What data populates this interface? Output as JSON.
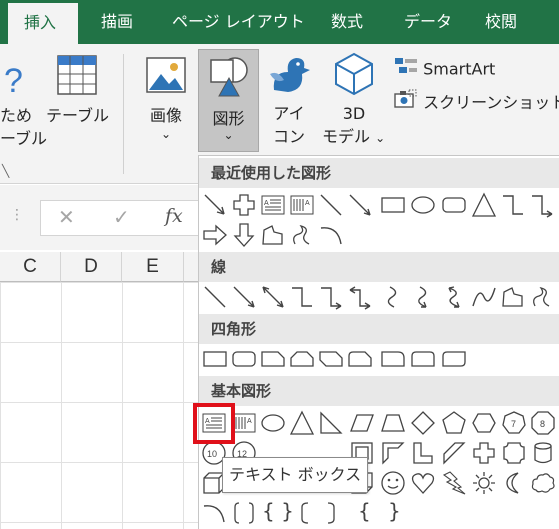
{
  "tabs": [
    {
      "label": "挿入",
      "active": true
    },
    {
      "label": "描画"
    },
    {
      "label": "ページ レイアウト"
    },
    {
      "label": "数式"
    },
    {
      "label": "データ"
    },
    {
      "label": "校閲"
    }
  ],
  "ribbon": {
    "partial_btn_line1": "ため",
    "partial_btn_line2": "ーブル",
    "table_label": "テーブル",
    "image_label": "画像",
    "shapes_label": "図形",
    "icons_label_1": "アイ",
    "icons_label_2": "コン",
    "model3d_label_1": "3D",
    "model3d_label_2": "モデル",
    "smartart_label": "SmartArt",
    "screenshot_label": "スクリーンショット",
    "chevron": "⌄"
  },
  "formula_bar": {
    "cancel_glyph": "✕",
    "enter_glyph": "✓",
    "fx_glyph": "fx"
  },
  "columns": [
    "C",
    "D",
    "E"
  ],
  "gallery": {
    "sections": {
      "recent": "最近使用した図形",
      "lines": "線",
      "rectangles": "四角形",
      "basic": "基本図形"
    },
    "octagon_number": "8",
    "heptagon_number": "7",
    "decagon_number": "10",
    "dodecagon_number": "12",
    "braces": "{ }",
    "open_brace": "{",
    "close_brace": "}"
  },
  "tooltip": "テキスト ボックス",
  "colors": {
    "accent": "#217346",
    "highlight": "#e0101a"
  }
}
